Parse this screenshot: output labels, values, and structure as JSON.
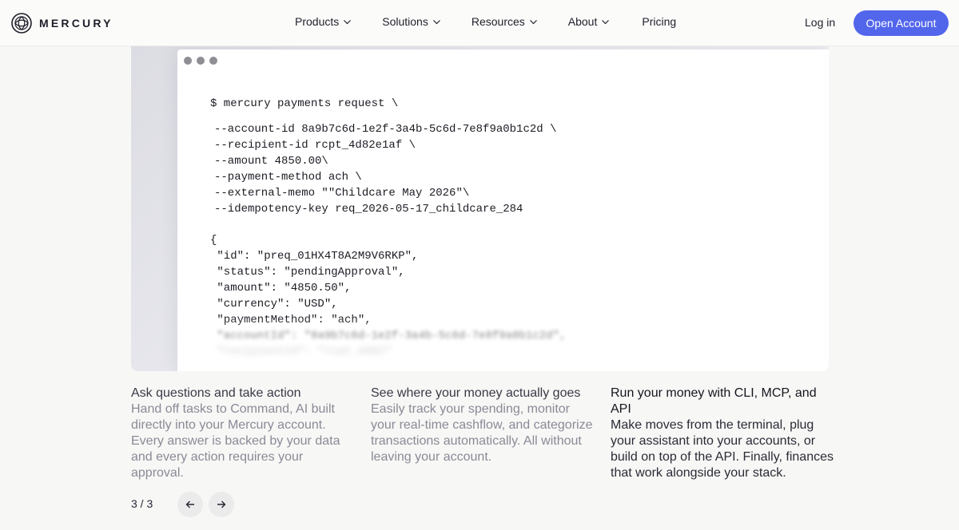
{
  "brand": {
    "name": "MERCURY",
    "logo_icon": "mercury-logo-icon"
  },
  "nav": {
    "items": [
      {
        "label": "Products",
        "has_dropdown": true
      },
      {
        "label": "Solutions",
        "has_dropdown": true
      },
      {
        "label": "Resources",
        "has_dropdown": true
      },
      {
        "label": "About",
        "has_dropdown": true
      },
      {
        "label": "Pricing",
        "has_dropdown": false
      }
    ],
    "login_label": "Log in",
    "cta_label": "Open Account",
    "cta_color": "#5266eb"
  },
  "terminal": {
    "command": "$ mercury payments request \\",
    "args": [
      "--account-id 8a9b7c6d-1e2f-3a4b-5c6d-7e8f9a0b1c2d \\",
      "--recipient-id rcpt_4d82e1af \\",
      "--amount 4850.00\\",
      "--payment-method ach \\",
      "--external-memo \"\"Childcare May 2026\"\\",
      "--idempotency-key req_2026-05-17_childcare_284"
    ],
    "response": [
      "{",
      " \"id\": \"preq_01HX4T8A2M9V6RKP\",",
      " \"status\": \"pendingApproval\",",
      " \"amount\": \"4850.50\",",
      " \"currency\": \"USD\",",
      " \"paymentMethod\": \"ach\","
    ]
  },
  "features": [
    {
      "title": "Ask questions and take action",
      "body": "Hand off tasks to Command, AI built directly into your Mercury account. Every answer is backed by your data and every action requires your approval."
    },
    {
      "title": "See where your money actually goes",
      "body": "Easily track your spending, monitor your real-time cashflow, and categorize transactions automatically. All without leaving your account."
    },
    {
      "title": "Run your money with CLI, MCP, and API",
      "body": "Make moves from the terminal, plug your assistant into your accounts, or build on top of the API. Finally, finances that work alongside your stack."
    }
  ],
  "pager": {
    "label": "3 / 3",
    "current": 3,
    "total": 3,
    "prev_icon": "arrow-left-icon",
    "next_icon": "arrow-right-icon"
  }
}
